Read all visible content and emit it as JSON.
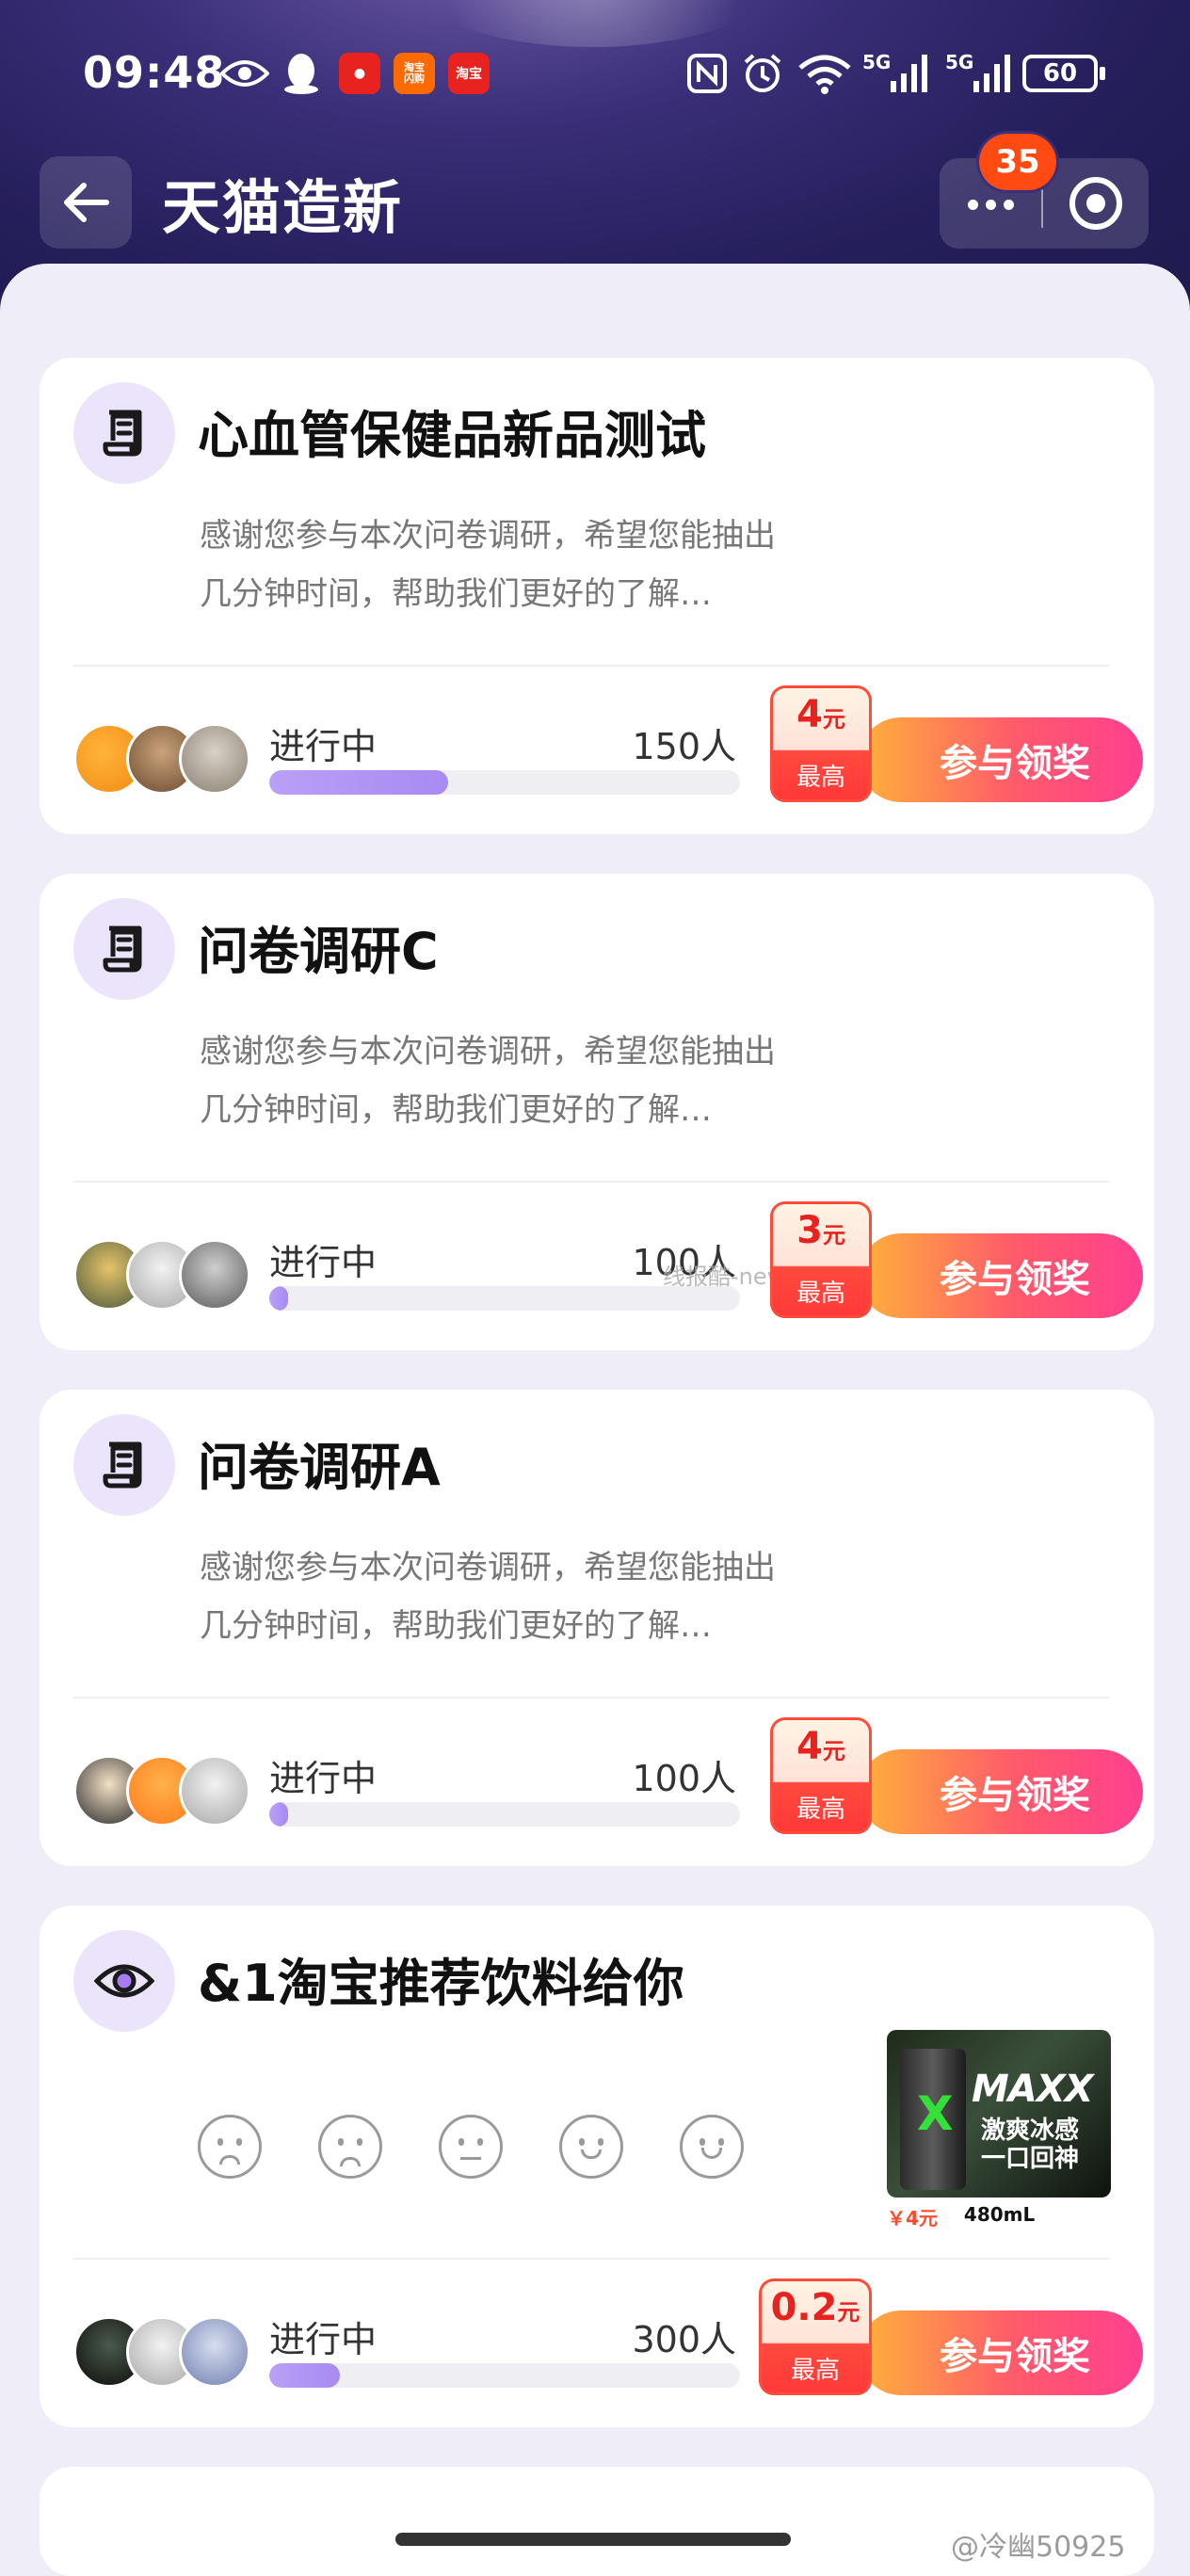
{
  "status_bar": {
    "time": "09:48",
    "signal_1": "5G",
    "signal_2": "5G",
    "battery": "60",
    "app_icon_1": "淘宝\n闪购",
    "app_icon_2": "淘宝"
  },
  "header": {
    "title": "天猫造新",
    "badge": "35"
  },
  "common": {
    "status": "进行中",
    "cta": "参与领奖",
    "reward_label": "最高",
    "currency": "元"
  },
  "cards": [
    {
      "title": "心血管保健品新品测试",
      "desc": "感谢您参与本次问卷调研，希望您能抽出几分钟时间，帮助我们更好的了解…",
      "count": "150人",
      "reward": "4",
      "progress": 0.38
    },
    {
      "title": "问卷调研C",
      "desc": "感谢您参与本次问卷调研，希望您能抽出几分钟时间，帮助我们更好的了解…",
      "count": "100人",
      "reward": "3",
      "progress": 0.04
    },
    {
      "title": "问卷调研A",
      "desc": "感谢您参与本次问卷调研，希望您能抽出几分钟时间，帮助我们更好的了解…",
      "count": "100人",
      "reward": "4",
      "progress": 0.04
    },
    {
      "title": "&1淘宝推荐饮料给你",
      "count": "300人",
      "reward": "0.2",
      "progress": 0.15,
      "product": {
        "brand": "MAXX",
        "slogan": "激爽冰感\n一口回神",
        "price": "￥4元",
        "volume": "480mL"
      }
    }
  ],
  "watermarks": {
    "bottom_right": "@冷幽50925",
    "center": "线报酷-new.xianbao.fun"
  },
  "colors": {
    "accent": "#ff5a6b",
    "reward_red": "#e8231f",
    "progress": "#a88af2"
  }
}
